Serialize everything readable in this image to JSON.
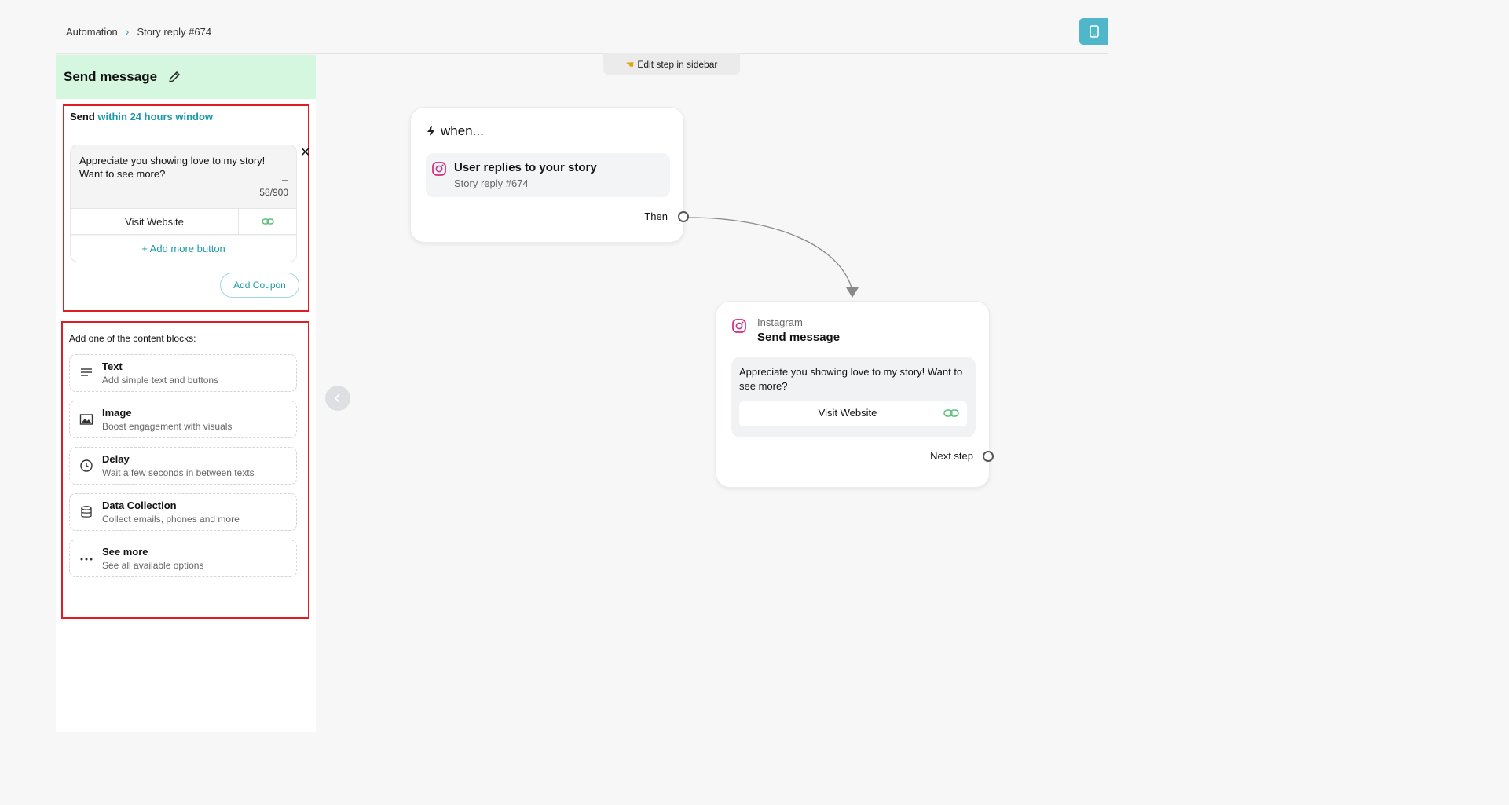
{
  "header": {
    "breadcrumb_root": "Automation",
    "breadcrumb_current": "Story reply #674"
  },
  "sidebar": {
    "title": "Send message",
    "send_prefix": "Send",
    "send_window": "within 24 hours window",
    "message_text": "Appreciate you showing love to my story! Want to see more?",
    "char_count": "58/900",
    "button_label": "Visit Website",
    "add_more_label": "+ Add more button",
    "coupon_label": "Add Coupon",
    "blocks_title": "Add one of the content blocks:",
    "blocks": [
      {
        "title": "Text",
        "desc": "Add simple text and buttons",
        "icon": "text-lines-icon"
      },
      {
        "title": "Image",
        "desc": "Boost engagement with visuals",
        "icon": "image-icon"
      },
      {
        "title": "Delay",
        "desc": "Wait a few seconds in between texts",
        "icon": "clock-icon"
      },
      {
        "title": "Data Collection",
        "desc": "Collect emails, phones and more",
        "icon": "database-icon"
      },
      {
        "title": "See more",
        "desc": "See all available options",
        "icon": "more-dots-icon"
      }
    ]
  },
  "canvas": {
    "hint": "Edit step in sidebar",
    "trigger": {
      "heading": "when...",
      "title": "User replies to your story",
      "subtitle": "Story reply #674",
      "then_label": "Then"
    },
    "action": {
      "source": "Instagram",
      "title": "Send message",
      "message": "Appreciate you showing love to my story! Want to see more?",
      "button_label": "Visit Website",
      "next_label": "Next step"
    }
  },
  "colors": {
    "accent": "#1b9aa8",
    "header_bg": "#d6f7df",
    "highlight_border": "#e01c24",
    "corner_button": "#4fb7c9"
  }
}
